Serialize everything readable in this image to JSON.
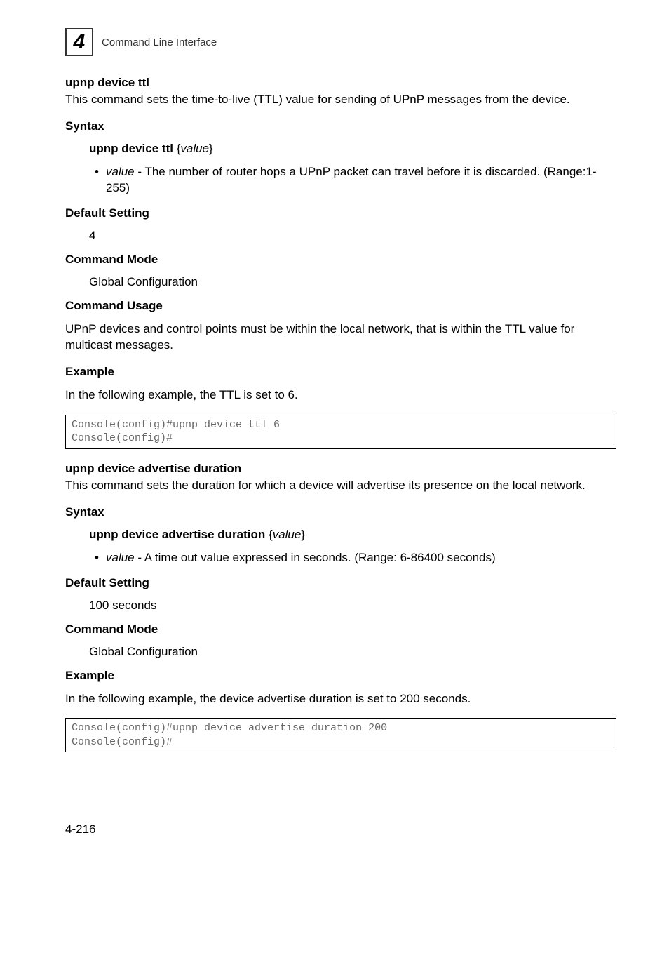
{
  "header": {
    "chapter_number": "4",
    "title": "Command Line Interface"
  },
  "sections": [
    {
      "title": "upnp device ttl",
      "intro": "This command sets the time-to-live (TTL) value for sending of UPnP messages from the device.",
      "syntax_heading": "Syntax",
      "syntax_cmd_bold": "upnp device ttl",
      "syntax_cmd_italic": "value",
      "bullet_param_italic": "value",
      "bullet_param_rest": " - The number of router hops a UPnP packet can travel before it is discarded. (Range:1-255)",
      "default_heading": "Default Setting",
      "default_value": "4",
      "mode_heading": "Command Mode",
      "mode_value": "Global Configuration",
      "usage_heading": "Command Usage",
      "usage_text": "UPnP devices and control points must be within the local network, that is within the TTL value for multicast messages.",
      "example_heading": "Example",
      "example_text": "In the following example, the TTL is set to 6.",
      "code": "Console(config)#upnp device ttl 6\nConsole(config)#"
    },
    {
      "title": "upnp device advertise duration",
      "intro": "This command sets the duration for which a device will advertise its presence on the local network.",
      "syntax_heading": "Syntax",
      "syntax_cmd_bold": "upnp device advertise duration",
      "syntax_cmd_italic": "value",
      "bullet_param_italic": "value",
      "bullet_param_rest": " - A time out value expressed in seconds. (Range: 6-86400 seconds)",
      "default_heading": "Default Setting",
      "default_value": "100 seconds",
      "mode_heading": "Command Mode",
      "mode_value": "Global Configuration",
      "example_heading": "Example",
      "example_text": "In the following example, the device advertise duration is set to 200 seconds.",
      "code": "Console(config)#upnp device advertise duration 200\nConsole(config)#"
    }
  ],
  "footer": {
    "page": "4-216"
  }
}
